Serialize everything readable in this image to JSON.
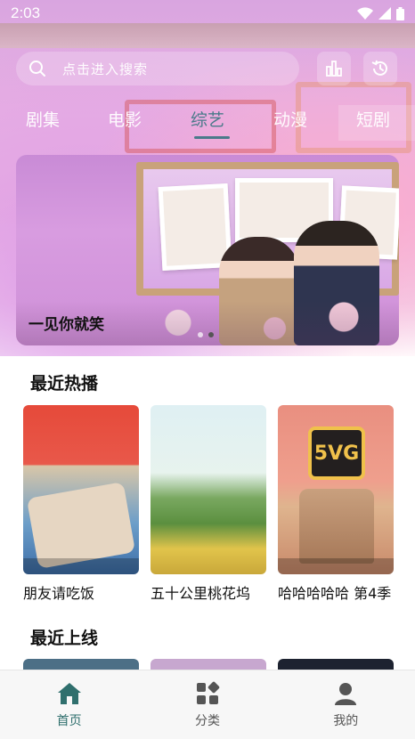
{
  "status_bar": {
    "time": "2:03"
  },
  "search": {
    "placeholder": "点击进入搜索"
  },
  "tabs": [
    {
      "label": "剧集"
    },
    {
      "label": "电影"
    },
    {
      "label": "综艺",
      "active": true
    },
    {
      "label": "动漫"
    },
    {
      "label": "短剧"
    }
  ],
  "banner": {
    "title": "一见你就笑",
    "page_count": 2,
    "active_page": 2
  },
  "recent_hot": {
    "title": "最近热播",
    "items": [
      {
        "name": "朋友请吃饭"
      },
      {
        "name": "五十公里桃花坞"
      },
      {
        "name": "哈哈哈哈哈 第4季"
      }
    ]
  },
  "recent_online": {
    "title": "最近上线"
  },
  "bottom_nav": [
    {
      "label": "首页",
      "icon": "home-icon",
      "active": true
    },
    {
      "label": "分类",
      "icon": "category-icon"
    },
    {
      "label": "我的",
      "icon": "user-icon"
    }
  ],
  "colors": {
    "accent": "#2f6f6d",
    "tab_active": "#4a7a8a"
  }
}
